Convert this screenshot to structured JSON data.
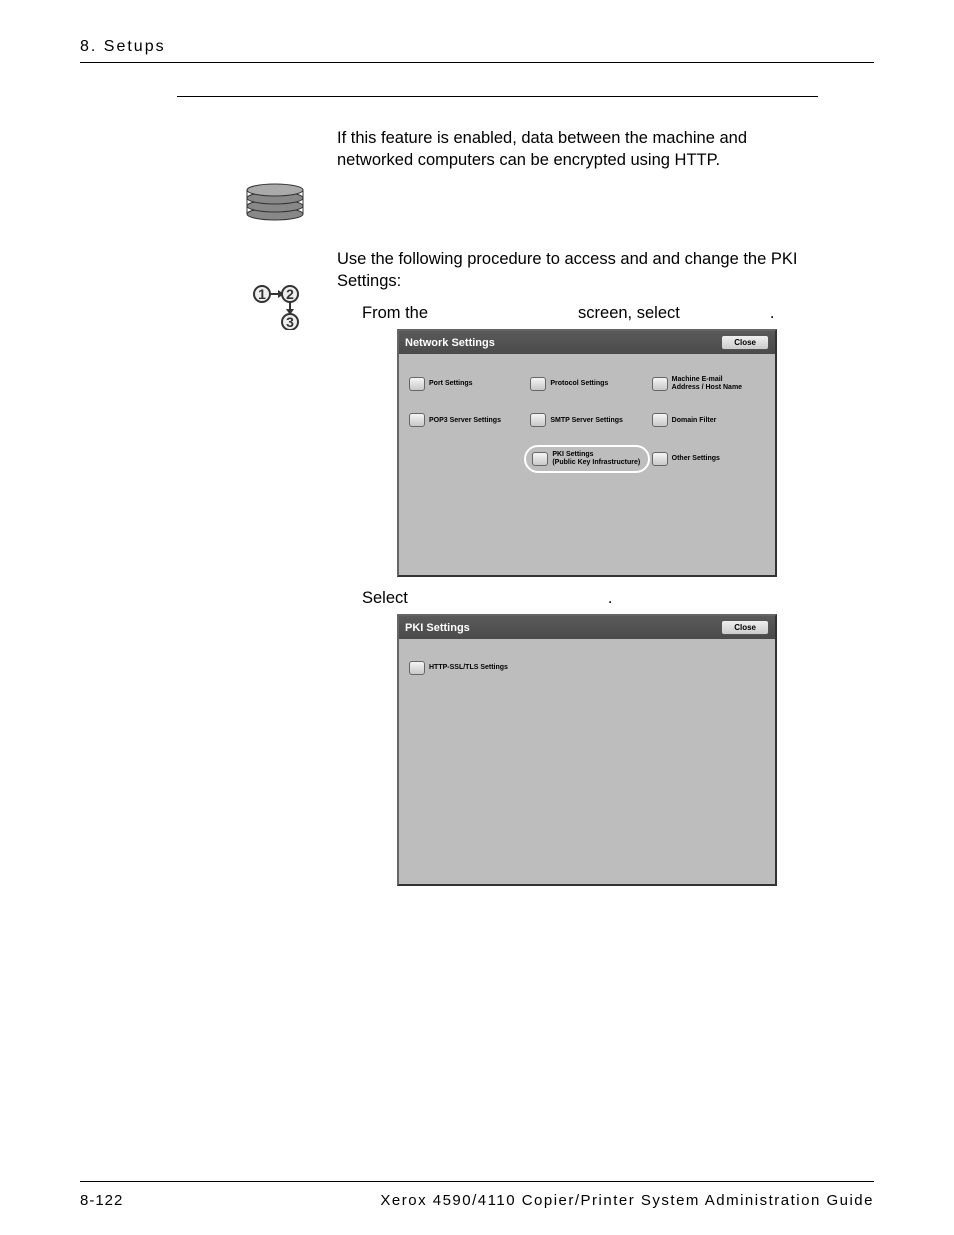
{
  "header": {
    "section": "8. Setups"
  },
  "body": {
    "p1": "If this feature is enabled, data between the machine and networked computers can be encrypted using HTTP.",
    "p2": "Use the following procedure to access and and change the PKI Settings:",
    "step1_a": "From the",
    "step1_b": "screen, select",
    "step1_c": ".",
    "step2_a": "Select",
    "step2_b": "."
  },
  "screenshot1": {
    "title": "Network Settings",
    "close": "Close",
    "buttons": {
      "r1c1": "Port Settings",
      "r1c2": "Protocol Settings",
      "r1c3_l1": "Machine E-mail",
      "r1c3_l2": "Address / Host Name",
      "r2c1": "POP3 Server Settings",
      "r2c2": "SMTP Server Settings",
      "r2c3": "Domain Filter",
      "r3c2_l1": "PKI Settings",
      "r3c2_l2": "(Public Key Infrastructure)",
      "r3c3": "Other Settings"
    }
  },
  "screenshot2": {
    "title": "PKI Settings",
    "close": "Close",
    "buttons": {
      "r1c1": "HTTP-SSL/TLS Settings"
    }
  },
  "footer": {
    "page": "8-122",
    "doc": "Xerox 4590/4110 Copier/Printer System Administration Guide"
  }
}
